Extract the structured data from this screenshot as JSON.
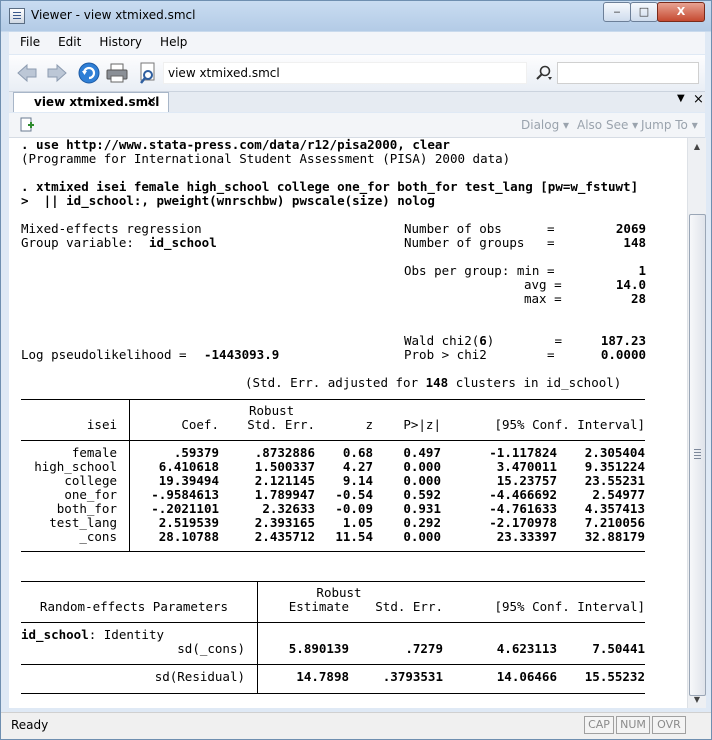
{
  "window": {
    "title": "Viewer - view xtmixed.smcl",
    "min_label": "‒",
    "max_label": "□",
    "close_label": "X"
  },
  "menu": [
    "File",
    "Edit",
    "History",
    "Help"
  ],
  "toolbar": {
    "address": "view xtmixed.smcl"
  },
  "tab": {
    "label": "view xtmixed.smcl",
    "close": "×",
    "dropdown": "▼",
    "panel_close": "×"
  },
  "subtoolbar": {
    "dialog": "Dialog ▾",
    "also_see": "Also See ▾",
    "jump_to": "Jump To ▾"
  },
  "output": {
    "cmd1": ". use http://www.stata-press.com/data/r12/pisa2000, clear",
    "note1": "(Programme for International Student Assessment (PISA) 2000 data)",
    "cmd2a": ". xtmixed isei female high_school college one_for both_for test_lang [pw=w_fstuwt]",
    "cmd2b": ">  || id_school:, pweight(wnrschbw) pwscale(size) nolog",
    "model_label": "Mixed-effects regression",
    "group_var_label": "Group variable:",
    "group_var": "id_school",
    "nobs_label": "Number of obs      =",
    "nobs": "2069",
    "ngroups_label": "Number of groups   =",
    "ngroups": "148",
    "obs_per_group": [
      {
        "label": "Obs per group: min =",
        "value": "1"
      },
      {
        "label": "avg =",
        "value": "14.0"
      },
      {
        "label": "max =",
        "value": "28"
      }
    ],
    "wald_label_pre": "Wald chi2(",
    "wald_df": "6",
    "wald_label_post": ")        =",
    "wald": "187.23",
    "logl_label": "Log pseudolikelihood =",
    "logl": "-1443093.9",
    "prob_label": "Prob > chi2        =",
    "prob": "0.0000",
    "se_note_pre": "(Std. Err. adjusted for ",
    "se_clusters": "148",
    "se_note_post": " clusters in id_school)"
  },
  "fixed_table": {
    "header_robust": "Robust",
    "columns": [
      "isei",
      "Coef.",
      "Std. Err.",
      "z",
      "P>|z|",
      "[95% Conf. Interval]"
    ],
    "rows": [
      {
        "name": "female",
        "coef": ".59379",
        "se": ".8732886",
        "z": "0.68",
        "p": "0.497",
        "lo": "-1.117824",
        "hi": "2.305404"
      },
      {
        "name": "high_school",
        "coef": "6.410618",
        "se": "1.500337",
        "z": "4.27",
        "p": "0.000",
        "lo": "3.470011",
        "hi": "9.351224"
      },
      {
        "name": "college",
        "coef": "19.39494",
        "se": "2.121145",
        "z": "9.14",
        "p": "0.000",
        "lo": "15.23757",
        "hi": "23.55231"
      },
      {
        "name": "one_for",
        "coef": "-.9584613",
        "se": "1.789947",
        "z": "-0.54",
        "p": "0.592",
        "lo": "-4.466692",
        "hi": "2.54977"
      },
      {
        "name": "both_for",
        "coef": "-.2021101",
        "se": "2.32633",
        "z": "-0.09",
        "p": "0.931",
        "lo": "-4.761633",
        "hi": "4.357413"
      },
      {
        "name": "test_lang",
        "coef": "2.519539",
        "se": "2.393165",
        "z": "1.05",
        "p": "0.292",
        "lo": "-2.170978",
        "hi": "7.210056"
      },
      {
        "name": "_cons",
        "coef": "28.10788",
        "se": "2.435712",
        "z": "11.54",
        "p": "0.000",
        "lo": "23.33397",
        "hi": "32.88179"
      }
    ]
  },
  "random_table": {
    "header_robust": "Robust",
    "columns": [
      "Random-effects Parameters",
      "Estimate",
      "Std. Err.",
      "[95% Conf. Interval]"
    ],
    "group_label": "id_school",
    "group_type": ": Identity",
    "rows": [
      {
        "name": "sd(_cons)",
        "est": "5.890139",
        "se": ".7279",
        "lo": "4.623113",
        "hi": "7.50441"
      },
      {
        "name": "sd(Residual)",
        "est": "14.7898",
        "se": ".3793531",
        "lo": "14.06466",
        "hi": "15.55232"
      }
    ]
  },
  "status": {
    "text": "Ready",
    "cap": "CAP",
    "num": "NUM",
    "ovr": "OVR"
  }
}
